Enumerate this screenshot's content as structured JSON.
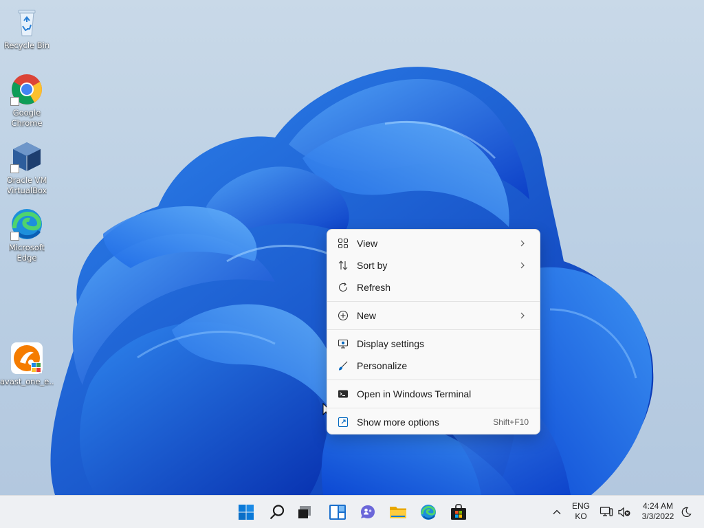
{
  "desktop": {
    "icons": [
      {
        "label": "Recycle Bin",
        "icon": "recycle-bin-icon"
      },
      {
        "label": "Google\nChrome",
        "icon": "chrome-icon"
      },
      {
        "label": "Oracle VM\nVirtualBox",
        "icon": "virtualbox-icon"
      },
      {
        "label": "Microsoft\nEdge",
        "icon": "edge-icon"
      },
      {
        "label": "avast_one_e...",
        "icon": "avast-icon"
      }
    ]
  },
  "context_menu": {
    "items": [
      {
        "label": "View",
        "icon": "grid-view-icon",
        "submenu": true
      },
      {
        "label": "Sort by",
        "icon": "sort-arrows-icon",
        "submenu": true
      },
      {
        "label": "Refresh",
        "icon": "refresh-icon"
      },
      {
        "label": "New",
        "icon": "plus-circle-icon",
        "submenu": true
      },
      {
        "label": "Display settings",
        "icon": "display-settings-icon"
      },
      {
        "label": "Personalize",
        "icon": "brush-icon"
      },
      {
        "label": "Open in Windows Terminal",
        "icon": "terminal-icon"
      },
      {
        "label": "Show more options",
        "icon": "more-options-icon",
        "accelerator": "Shift+F10"
      }
    ]
  },
  "taskbar": {
    "apps": [
      "start-icon",
      "search-icon",
      "task-view-icon",
      "widgets-icon",
      "chat-icon",
      "file-explorer-icon",
      "edge-icon",
      "store-icon"
    ],
    "tray": {
      "language_top": "ENG",
      "language_bottom": "KO",
      "time": "4:24 AM",
      "date": "3/3/2022"
    }
  },
  "colors": {
    "accent": "#0067c0",
    "bloom_dark": "#0a3cc4",
    "bloom_light": "#3a8ff0",
    "menu_bg": "#f9f9f9",
    "taskbar_bg": "#eef0f3"
  }
}
